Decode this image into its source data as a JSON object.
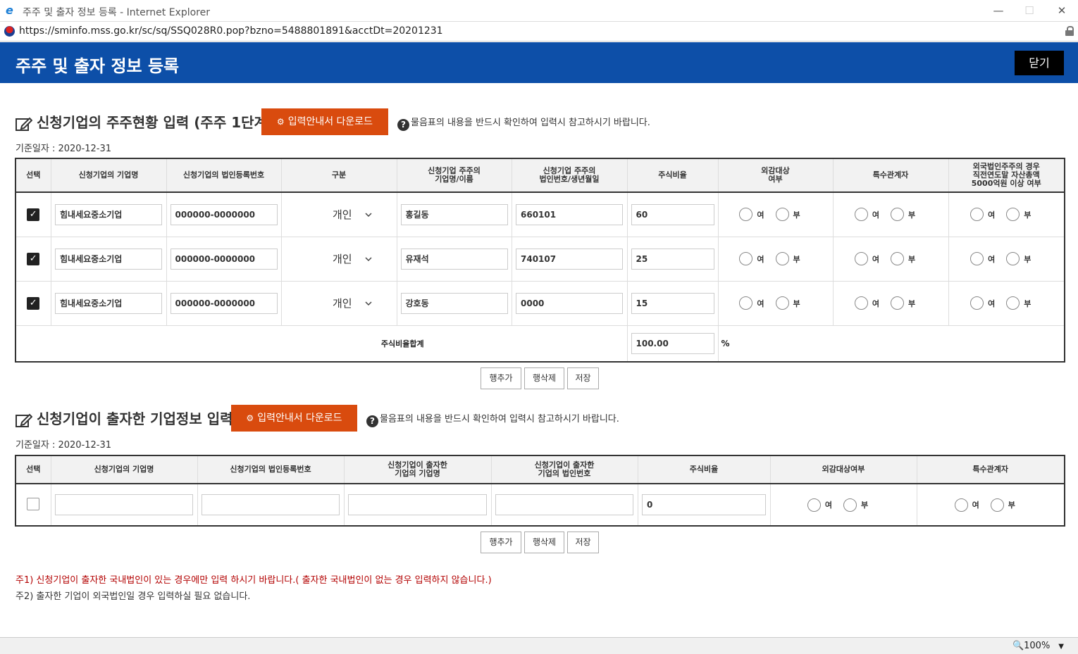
{
  "window": {
    "title": "주주 및 출자 정보 등록 - Internet Explorer",
    "url": "https://sminfo.mss.go.kr/sc/sq/SSQ028R0.pop?bzno=5488801891&acctDt=20201231",
    "minimize": "—",
    "maximize": "☐",
    "close": "✕"
  },
  "header": {
    "title": "주주 및 출자 정보 등록",
    "close_label": "닫기"
  },
  "section1": {
    "title": "신청기업의 주주현황 입력 (주주 1단계)",
    "download_label": "입력안내서 다운로드",
    "help_text": "물음표의 내용을 반드시 확인하여 입력시 참고하시기 바랍니다.",
    "base_date": "기준일자 : 2020-12-31",
    "columns": [
      "선택",
      "신청기업의 기업명",
      "신청기업의 법인등록번호",
      "구분",
      "신청기업 주주의\n기업명/이름",
      "신청기업 주주의\n법인번호/생년월일",
      "주식비율",
      "외감대상\n여부",
      "특수관계자",
      "외국법인주주의 경우\n직전연도말 자산총액\n5000억원 이상 여부"
    ],
    "rows": [
      {
        "checked": true,
        "company": "힘내세요중소기업",
        "corp_no": "000000-0000000",
        "type": "개인",
        "holder": "홍길동",
        "holder_no": "660101",
        "ratio": "60"
      },
      {
        "checked": true,
        "company": "힘내세요중소기업",
        "corp_no": "000000-0000000",
        "type": "개인",
        "holder": "유재석",
        "holder_no": "740107",
        "ratio": "25"
      },
      {
        "checked": true,
        "company": "힘내세요중소기업",
        "corp_no": "000000-0000000",
        "type": "개인",
        "holder": "강호동",
        "holder_no": "0000",
        "ratio": "15"
      }
    ],
    "radio_yes": "여",
    "radio_no": "부",
    "total_label": "주식비율합계",
    "total_value": "100.00",
    "percent": "%"
  },
  "section2": {
    "title": "신청기업이 출자한 기업정보 입력",
    "download_label": "입력안내서 다운로드",
    "help_text": "물음표의 내용을 반드시 확인하여 입력시 참고하시기 바랍니다.",
    "base_date": "기준일자 : 2020-12-31",
    "columns": [
      "선택",
      "신청기업의 기업명",
      "신청기업의 법인등록번호",
      "신청기업이 출자한\n기업의 기업명",
      "신청기업이 출자한\n기업의 법인번호",
      "주식비율",
      "외감대상여부",
      "특수관계자"
    ],
    "row": {
      "checked": false,
      "ratio": "0"
    },
    "radio_yes": "여",
    "radio_no": "부"
  },
  "buttons": {
    "add_row": "행추가",
    "delete_row": "행삭제",
    "save": "저장"
  },
  "notes": {
    "note1": "주1) 신청기업이 출자한 국내법인이 있는 경우에만 입력 하시기 바랍니다.( 출자한 국내법인이 없는 경우 입력하지 않습니다.)",
    "note2": "주2) 출자한 기업이 외국법인일 경우 입력하실 필요 없습니다."
  },
  "status": {
    "zoom": "100%"
  },
  "colors": {
    "header_bg": "#0d4fa8",
    "download_btn": "#d94b0e",
    "note_red": "#b30000"
  },
  "icons": [
    "ie-logo-icon",
    "site-icon",
    "lock-icon",
    "edit-icon",
    "gear-icon",
    "help-icon",
    "checkbox",
    "chevron-down-icon",
    "zoom-icon"
  ]
}
